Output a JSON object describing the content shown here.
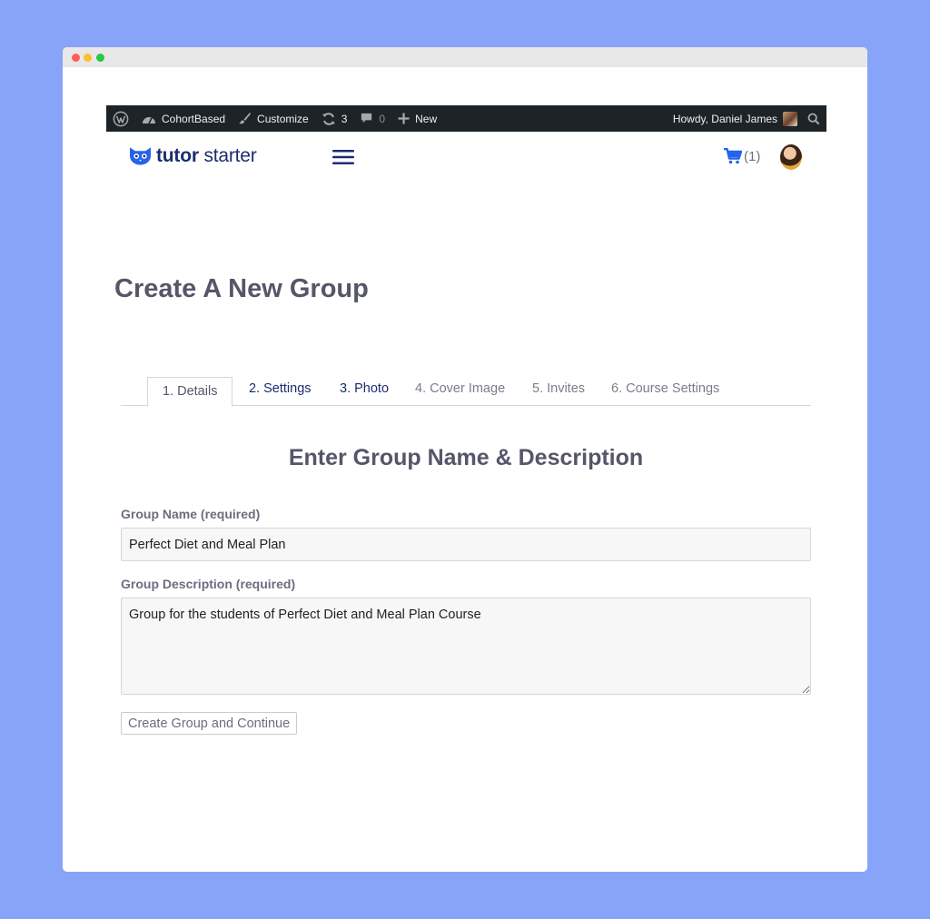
{
  "adminbar": {
    "site_name": "CohortBased",
    "customize_label": "Customize",
    "updates_count": "3",
    "comments_count": "0",
    "new_label": "New",
    "howdy_label": "Howdy, Daniel James"
  },
  "header": {
    "logo_bold": "tutor",
    "logo_light": " starter",
    "cart_count": "(1)"
  },
  "page": {
    "title": "Create A New Group",
    "tabs": [
      {
        "label": "1. Details",
        "state": "active"
      },
      {
        "label": "2. Settings",
        "state": "enabled"
      },
      {
        "label": "3. Photo",
        "state": "enabled"
      },
      {
        "label": "4. Cover Image",
        "state": "disabled"
      },
      {
        "label": "5. Invites",
        "state": "disabled"
      },
      {
        "label": "6. Course Settings",
        "state": "disabled"
      }
    ],
    "section_title": "Enter Group Name & Description",
    "form": {
      "name_label": "Group Name (required)",
      "name_value": "Perfect Diet and Meal Plan",
      "desc_label": "Group Description (required)",
      "desc_value": "Group for the students of Perfect Diet and Meal Plan Course",
      "submit_label": "Create Group and Continue"
    }
  },
  "colors": {
    "background": "#88a4f9",
    "adminbar": "#1d2327",
    "brand_navy": "#1c2c6f",
    "brand_blue": "#2563eb",
    "heading": "#555669"
  },
  "icons": {
    "wp_logo": "wordpress-logo-icon",
    "dashboard": "dashboard-gauge-icon",
    "customize": "paintbrush-icon",
    "updates": "refresh-icon",
    "comments": "speech-bubble-icon",
    "new": "plus-icon",
    "search": "search-icon",
    "cart": "shopping-cart-icon",
    "menu": "hamburger-menu-icon"
  }
}
